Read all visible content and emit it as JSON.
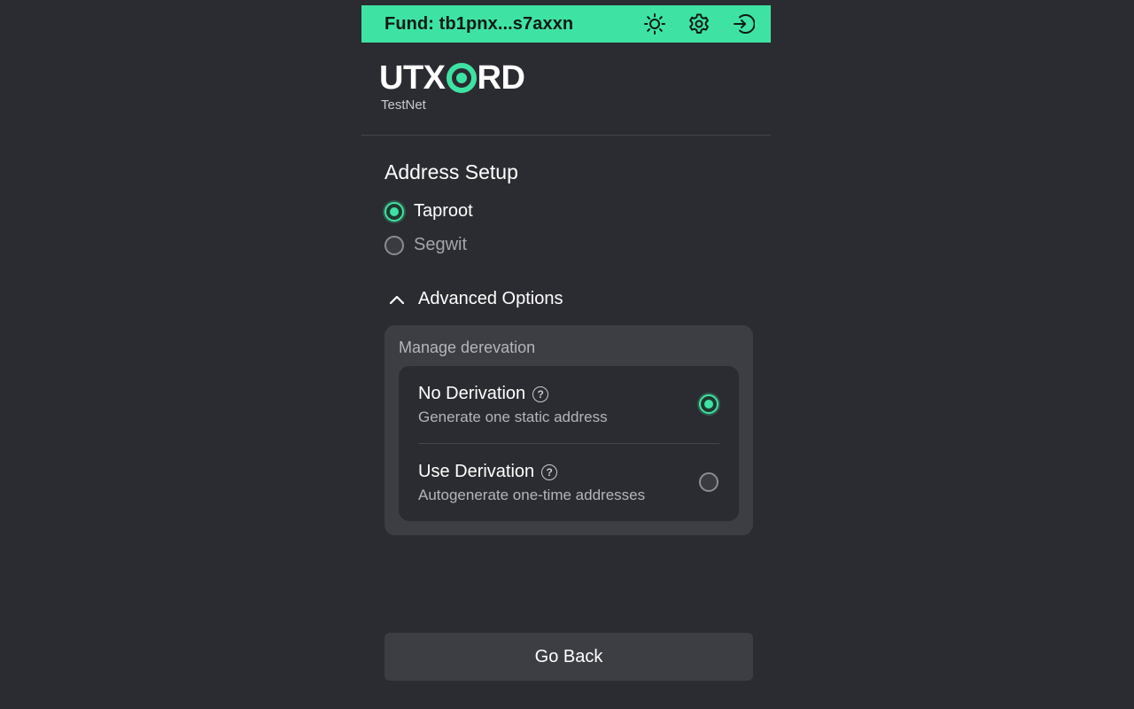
{
  "header": {
    "fund_label": "Fund: tb1pnx...s7axxn",
    "icons": [
      "sun-icon",
      "gear-icon",
      "login-icon"
    ],
    "accent": "#3ee3a3"
  },
  "logo": {
    "word_left": "UTX",
    "word_right": "RD",
    "network": "TestNet"
  },
  "address_setup": {
    "title": "Address Setup",
    "options": [
      {
        "label": "Taproot",
        "selected": true
      },
      {
        "label": "Segwit",
        "selected": false
      }
    ]
  },
  "advanced": {
    "toggle_label": "Advanced Options",
    "expanded": true,
    "section_title": "Manage derevation",
    "options": [
      {
        "title": "No Derivation",
        "description": "Generate one static address",
        "selected": true
      },
      {
        "title": "Use Derivation",
        "description": "Autogenerate one-time addresses",
        "selected": false
      }
    ]
  },
  "footer": {
    "back_label": "Go Back"
  }
}
